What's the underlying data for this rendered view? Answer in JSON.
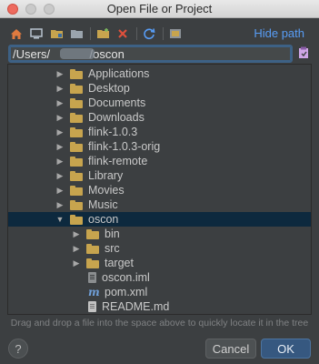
{
  "window": {
    "title": "Open File or Project"
  },
  "toolbar": {
    "icons": [
      "home-icon",
      "desktop-icon",
      "project-folder-icon",
      "module-folder-icon",
      "new-folder-icon",
      "delete-icon",
      "refresh-icon",
      "toggle-hidden-icon"
    ],
    "hide_path_label": "Hide path"
  },
  "path": {
    "value": "/Users/            /oscon"
  },
  "tree": {
    "items": [
      {
        "label": "Applications",
        "type": "folder",
        "arrow": "▶"
      },
      {
        "label": "Desktop",
        "type": "folder",
        "arrow": "▶"
      },
      {
        "label": "Documents",
        "type": "folder",
        "arrow": "▶"
      },
      {
        "label": "Downloads",
        "type": "folder",
        "arrow": "▶"
      },
      {
        "label": "flink-1.0.3",
        "type": "folder",
        "arrow": "▶"
      },
      {
        "label": "flink-1.0.3-orig",
        "type": "folder",
        "arrow": "▶"
      },
      {
        "label": "flink-remote",
        "type": "folder",
        "arrow": "▶"
      },
      {
        "label": "Library",
        "type": "folder",
        "arrow": "▶"
      },
      {
        "label": "Movies",
        "type": "folder",
        "arrow": "▶"
      },
      {
        "label": "Music",
        "type": "folder",
        "arrow": "▶"
      },
      {
        "label": "oscon",
        "type": "folder",
        "arrow": "▼",
        "selected": true
      },
      {
        "label": "bin",
        "type": "folder",
        "arrow": "▶"
      },
      {
        "label": "src",
        "type": "folder",
        "arrow": "▶"
      },
      {
        "label": "target",
        "type": "folder",
        "arrow": "▶"
      },
      {
        "label": "oscon.iml",
        "type": "iml-file"
      },
      {
        "label": "pom.xml",
        "type": "maven-file"
      },
      {
        "label": "README.md",
        "type": "markdown-file"
      }
    ]
  },
  "footer": {
    "hint": "Drag and drop a file into the space above to quickly locate it in the tree",
    "help_label": "?",
    "cancel_label": "Cancel",
    "ok_label": "OK"
  },
  "colors": {
    "background": "#3c3f41",
    "selection": "#0d293e",
    "link": "#589df6",
    "folder": "#c7a44e",
    "ok_button": "#365880"
  }
}
